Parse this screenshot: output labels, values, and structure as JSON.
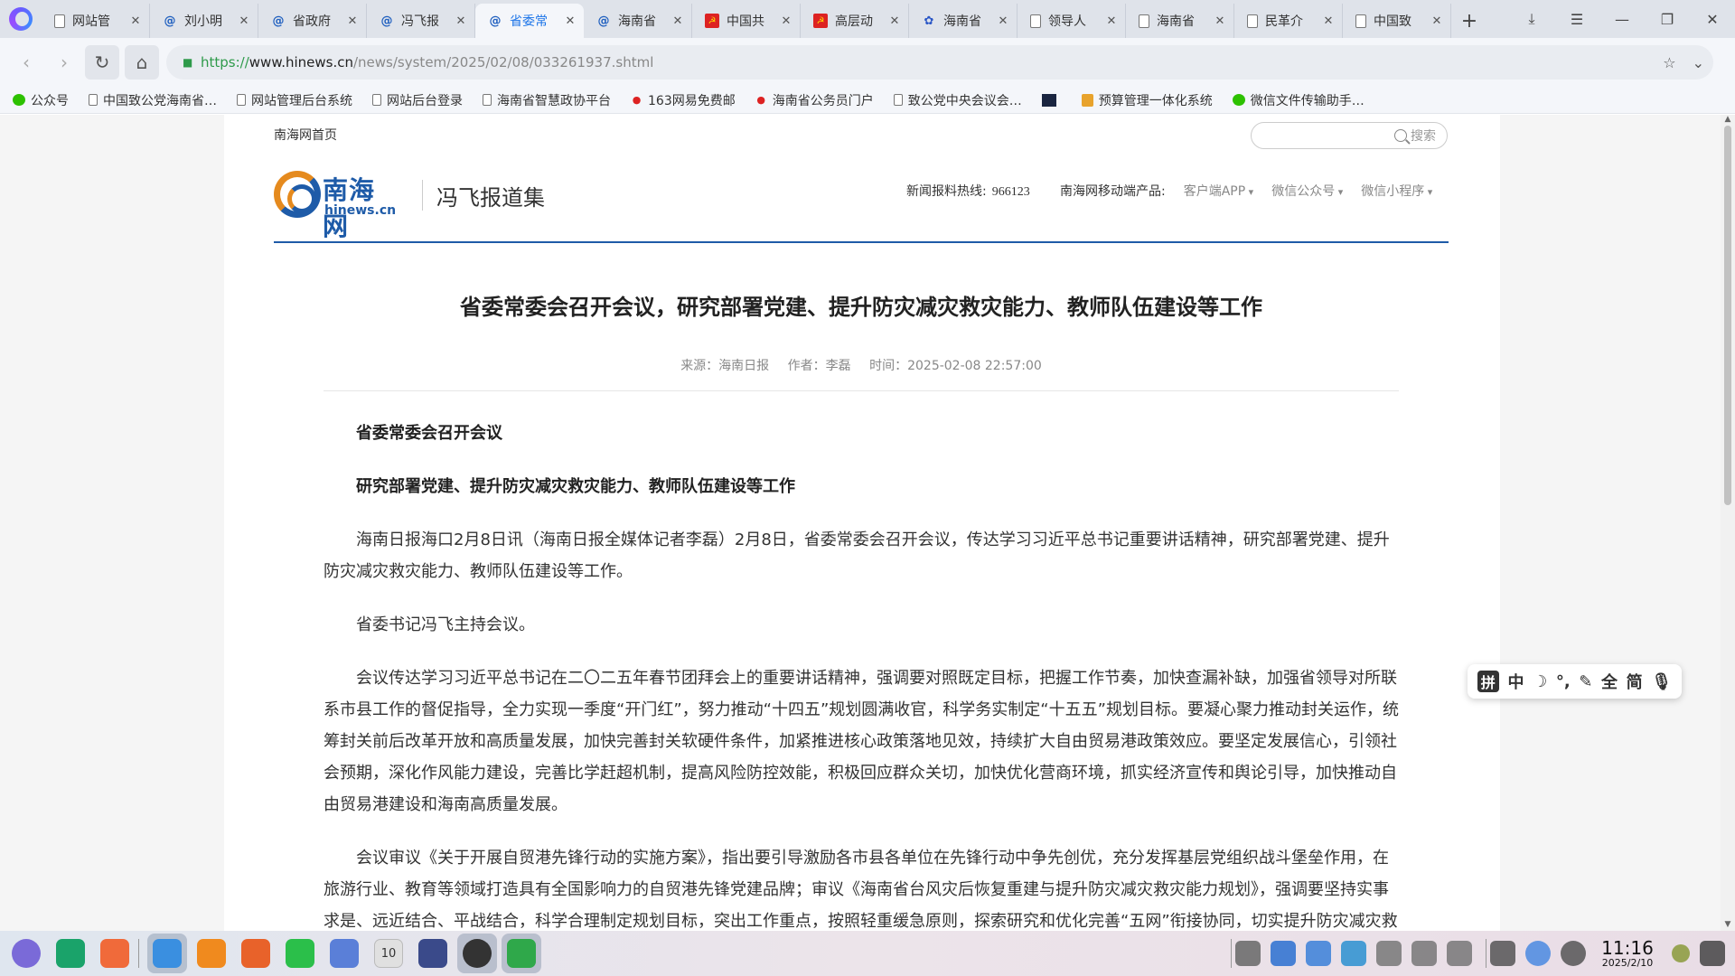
{
  "browser": {
    "tabs": [
      {
        "title": "网站管",
        "icon": "doc"
      },
      {
        "title": "刘小明",
        "icon": "spiral"
      },
      {
        "title": "省政府",
        "icon": "spiral"
      },
      {
        "title": "冯飞报",
        "icon": "spiral"
      },
      {
        "title": "省委常",
        "icon": "spiral",
        "active": true
      },
      {
        "title": "海南省",
        "icon": "spiral"
      },
      {
        "title": "中国共",
        "icon": "red"
      },
      {
        "title": "高层动",
        "icon": "red"
      },
      {
        "title": "海南省",
        "icon": "paw"
      },
      {
        "title": "领导人",
        "icon": "doc"
      },
      {
        "title": "海南省",
        "icon": "doc"
      },
      {
        "title": "民革介",
        "icon": "doc"
      },
      {
        "title": "中国致",
        "icon": "doc"
      }
    ],
    "new_tab": "+",
    "url": {
      "scheme": "https://",
      "host": "www.hinews.cn",
      "path": "/news/system/2025/02/08/033261937.shtml"
    },
    "bookmarks": [
      {
        "label": "公众号",
        "icon": "wx"
      },
      {
        "label": "中国致公党海南省…",
        "icon": "doc"
      },
      {
        "label": "网站管理后台系统",
        "icon": "doc"
      },
      {
        "label": "网站后台登录",
        "icon": "doc"
      },
      {
        "label": "海南省智慧政协平台",
        "icon": "doc"
      },
      {
        "label": "163网易免费邮",
        "icon": "red"
      },
      {
        "label": "海南省公务员门户",
        "icon": "red"
      },
      {
        "label": "致公党中央会议会…",
        "icon": "doc"
      },
      {
        "label": "",
        "icon": "dark"
      },
      {
        "label": "预算管理一体化系统",
        "icon": "gold"
      },
      {
        "label": "微信文件传输助手…",
        "icon": "wx"
      }
    ]
  },
  "site": {
    "home_link": "南海网首页",
    "search_label": "搜索",
    "logo_cn": "南海网",
    "logo_en": "hinews.cn",
    "section_title": "冯飞报道集",
    "hotline_label": "新闻报料热线:",
    "hotline_number": "966123",
    "mobile_label": "南海网移动端产品:",
    "mobile_items": [
      "客户端APP",
      "微信公众号",
      "微信小程序"
    ]
  },
  "article": {
    "title": "省委常委会召开会议，研究部署党建、提升防灾减灾救灾能力、教师队伍建设等工作",
    "source": "来源：海南日报",
    "author": "作者：李磊",
    "time": "时间：2025-02-08 22:57:00",
    "paragraphs": [
      {
        "text": "省委常委会召开会议",
        "bold": true
      },
      {
        "text": "研究部署党建、提升防灾减灾救灾能力、教师队伍建设等工作",
        "bold": true
      },
      {
        "text": "海南日报海口2月8日讯（海南日报全媒体记者李磊）2月8日，省委常委会召开会议，传达学习习近平总书记重要讲话精神，研究部署党建、提升防灾减灾救灾能力、教师队伍建设等工作。",
        "bold": false
      },
      {
        "text": "省委书记冯飞主持会议。",
        "bold": false
      },
      {
        "text": "会议传达学习习近平总书记在二〇二五年春节团拜会上的重要讲话精神，强调要对照既定目标，把握工作节奏，加快查漏补缺，加强省领导对所联系市县工作的督促指导，全力实现一季度“开门红”，努力推动“十四五”规划圆满收官，科学务实制定“十五五”规划目标。要凝心聚力推动封关运作，统筹封关前后改革开放和高质量发展，加快完善封关软硬件条件，加紧推进核心政策落地见效，持续扩大自由贸易港政策效应。要坚定发展信心，引领社会预期，深化作风能力建设，完善比学赶超机制，提高风险防控效能，积极回应群众关切，加快优化营商环境，抓实经济宣传和舆论引导，加快推动自由贸易港建设和海南高质量发展。",
        "bold": false
      },
      {
        "text": "会议审议《关于开展自贸港先锋行动的实施方案》，指出要引导激励各市县各单位在先锋行动中争先创优，充分发挥基层党组织战斗堡垒作用，在旅游行业、教育等领域打造具有全国影响力的自贸港先锋党建品牌；审议《海南省台风灾后恢复重建与提升防灾减灾救灾能力规划》，强调要坚持实事求是、远近结合、平战结合，科学合理制定规划目标，突出工作重点，按照轻重缓急原则，探索研究和优化完善“五网”衔接协同，切实提升防灾减灾救",
        "bold": false
      }
    ]
  },
  "ime": {
    "items": [
      "拼",
      "中",
      "☽",
      "°,",
      "✎",
      "全",
      "简",
      "🎙"
    ]
  },
  "taskbar": {
    "clock_time": "11:16",
    "clock_date": "2025/2/10",
    "calendar_day": "10",
    "app_colors": [
      "#7a6ad8",
      "#1aa36a",
      "#f06a3a",
      "#3a8fe0",
      "#f08a1e",
      "#e8622a",
      "#2bbf4a",
      "#5a7fd8",
      "#e0e0e0",
      "#3a4a8a",
      "#333333",
      "#2fa84a"
    ]
  },
  "colors": {
    "brand_blue": "#1e5ba8",
    "brand_orange": "#e58a1e",
    "url_green": "#2e9a4a",
    "active_tab": "#1a73e8"
  }
}
